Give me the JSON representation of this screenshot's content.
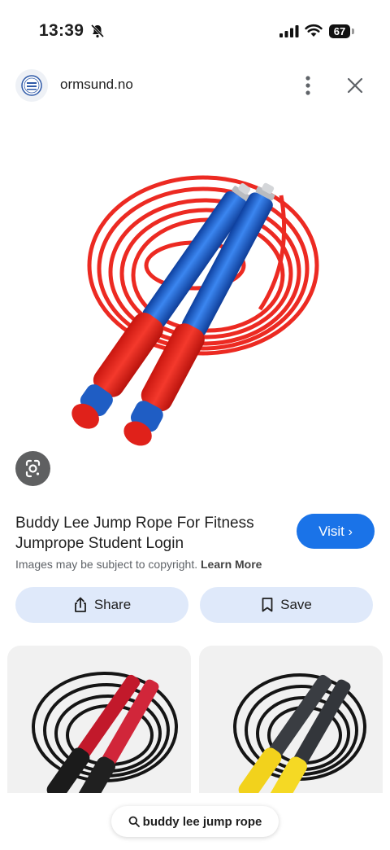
{
  "status_bar": {
    "time": "13:39",
    "battery": "67"
  },
  "site": {
    "name": "ormsund.no"
  },
  "result": {
    "title": "Buddy Lee Jump Rope For Fitness Jumprope Student Login",
    "visit_label": "Visit",
    "copyright_text": "Images may be subject to copyright.",
    "learn_more": "Learn More"
  },
  "actions": {
    "share_label": "Share",
    "save_label": "Save"
  },
  "search": {
    "query": "buddy lee jump rope"
  },
  "colors": {
    "accent": "#1a73e8",
    "button_bg": "#dfe9fa",
    "rope_red": "#ee2722",
    "handle_blue": "#1b5fd6"
  }
}
